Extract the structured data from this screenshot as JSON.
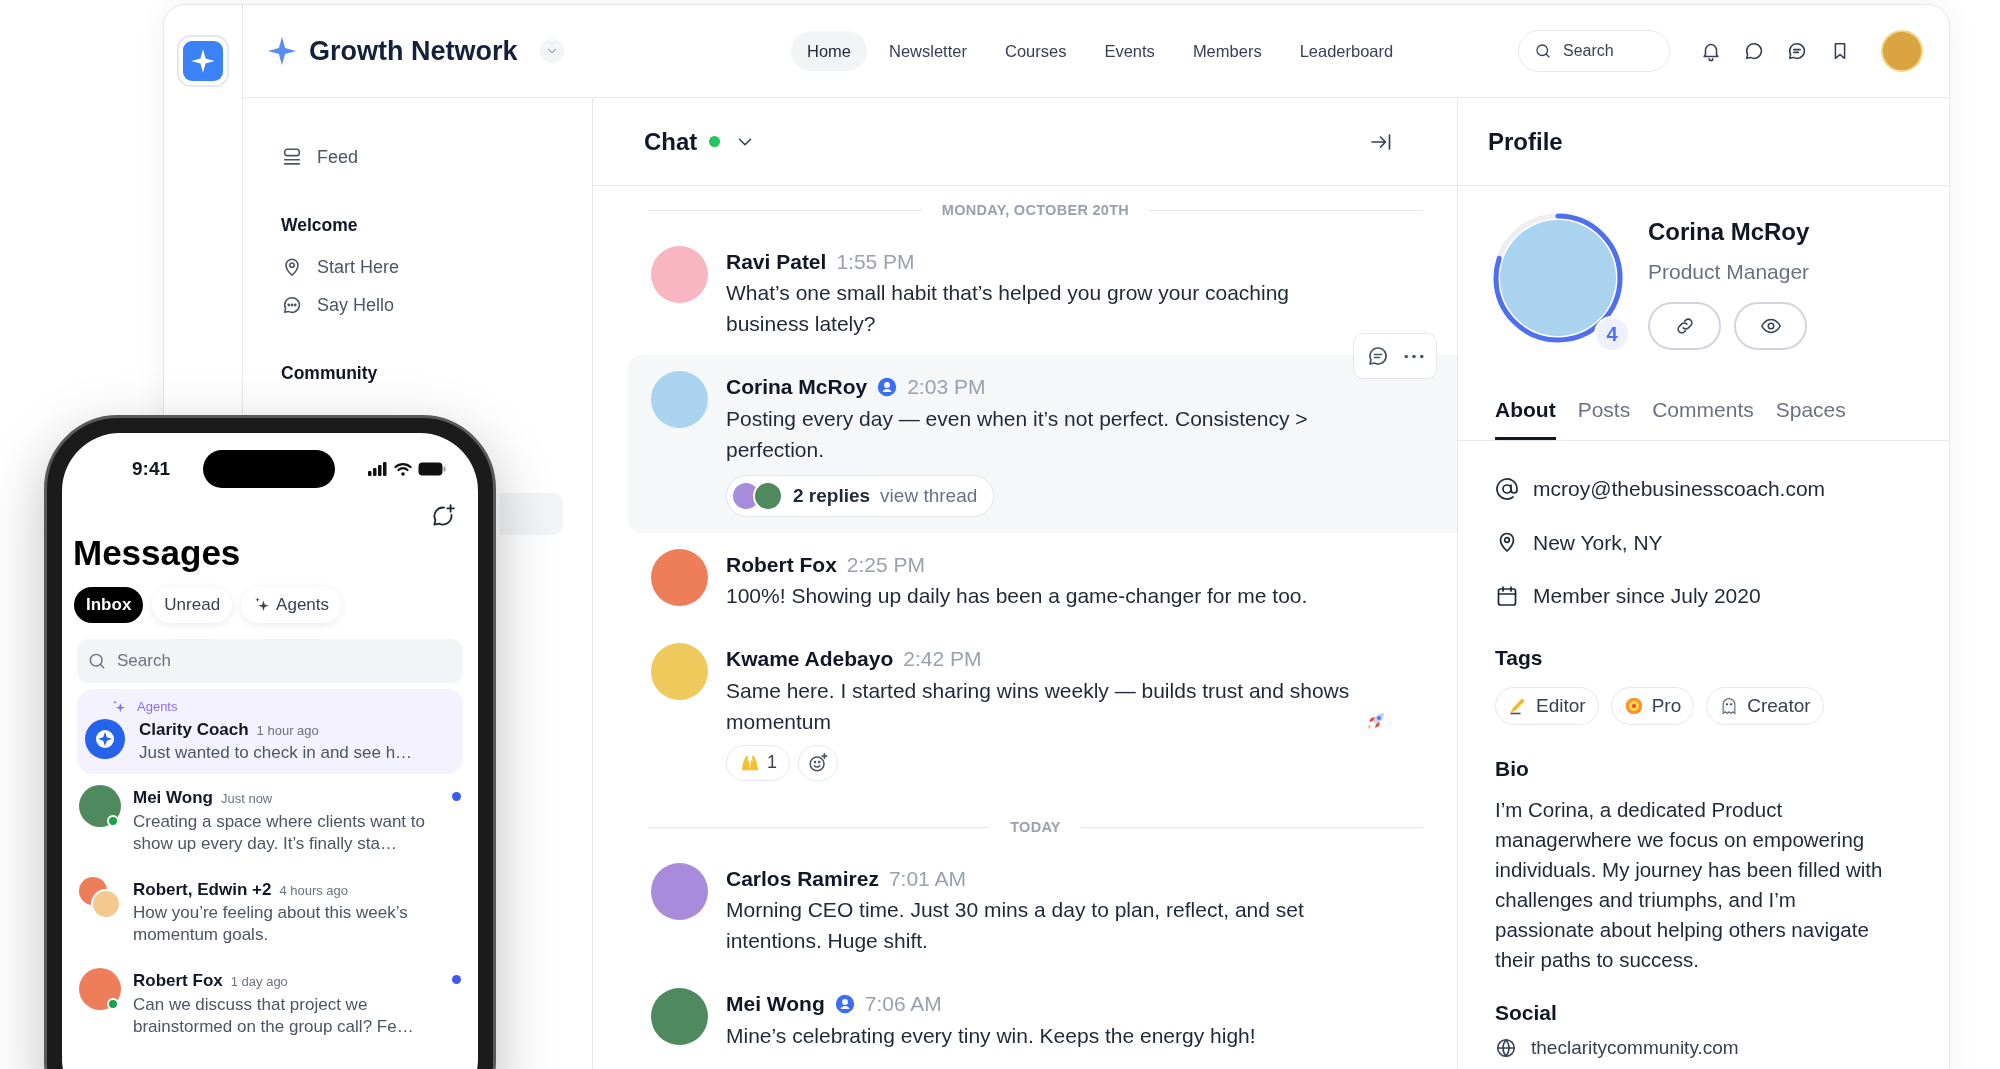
{
  "brand": {
    "name": "Growth Network"
  },
  "nav": [
    {
      "label": "Home",
      "selected": true
    },
    {
      "label": "Newsletter",
      "selected": false
    },
    {
      "label": "Courses",
      "selected": false
    },
    {
      "label": "Events",
      "selected": false
    },
    {
      "label": "Members",
      "selected": false
    },
    {
      "label": "Leaderboard",
      "selected": false
    }
  ],
  "search": {
    "placeholder": "Search"
  },
  "sidebar": {
    "sections": [
      {
        "items": [
          {
            "label": "Feed"
          }
        ]
      },
      {
        "heading": "Welcome",
        "items": [
          {
            "label": "Start Here"
          },
          {
            "label": "Say Hello"
          }
        ]
      },
      {
        "heading": "Community"
      }
    ]
  },
  "chat": {
    "title": "Chat",
    "online": true,
    "groups": [
      {
        "date": "MONDAY, OCTOBER 20TH",
        "messages": [
          {
            "name": "Ravi Patel",
            "time": "1:55 PM",
            "text": "What’s one small habit that’s helped you grow your coaching business lately?",
            "kind": "text",
            "verified": false,
            "highlighted": false,
            "color": "#f7b6c2"
          },
          {
            "name": "Corina McRoy",
            "time": "2:03 PM",
            "text": "Posting every day — even when it’s not perfect. Consistency > perfection.",
            "kind": "text",
            "verified": true,
            "highlighted": true,
            "color": "#a9d3ee",
            "thread": {
              "replies": "2 replies",
              "link": "view thread"
            }
          },
          {
            "name": "Robert Fox",
            "time": "2:25 PM",
            "text": "100%! Showing up daily has been a game-changer for me too.",
            "kind": "text",
            "verified": false,
            "highlighted": false,
            "color": "#ee7d5a"
          },
          {
            "name": "Kwame Adebayo",
            "time": "2:42 PM",
            "text": "Same here. I started sharing wins weekly — builds trust and shows momentum",
            "kind": "text-emoji",
            "verified": false,
            "highlighted": false,
            "color": "#efc95c",
            "reactions": [
              {
                "count": "1"
              }
            ]
          }
        ]
      },
      {
        "date": "TODAY",
        "messages": [
          {
            "name": "Carlos Ramirez",
            "time": "7:01 AM",
            "text": "Morning CEO time. Just 30 mins a day to plan, reflect, and set intentions. Huge shift.",
            "kind": "text",
            "verified": false,
            "highlighted": false,
            "color": "#a98bdc"
          },
          {
            "name": "Mei Wong",
            "time": "7:06 AM",
            "text": "Mine’s celebrating every tiny win. Keeps the energy high!",
            "kind": "text",
            "verified": true,
            "highlighted": false,
            "color": "#4f8a5f"
          }
        ]
      }
    ]
  },
  "profile": {
    "title": "Profile",
    "name": "Corina McRoy",
    "role": "Product Manager",
    "level": 0.8,
    "badge": "4",
    "tabs": [
      {
        "label": "About",
        "selected": true
      },
      {
        "label": "Posts",
        "selected": false
      },
      {
        "label": "Comments",
        "selected": false
      },
      {
        "label": "Spaces",
        "selected": false
      }
    ],
    "details": [
      {
        "kind": "email",
        "text": "mcroy@thebusinesscoach.com"
      },
      {
        "kind": "location",
        "text": "New York, NY"
      },
      {
        "kind": "joined",
        "text": "Member since July 2020"
      }
    ],
    "tags_heading": "Tags",
    "tags": [
      {
        "label": "Editor"
      },
      {
        "label": "Pro"
      },
      {
        "label": "Creator"
      }
    ],
    "bio_heading": "Bio",
    "bio": "I’m Corina, a dedicated Product managerwhere we focus on empowering individuals. My journey has been filled with challenges and triumphs, and I’m passionate about helping others navigate their paths to success.",
    "social_heading": "Social",
    "social": [
      "theclaritycommunity.com"
    ]
  },
  "phone": {
    "time": "9:41",
    "title": "Messages",
    "filters": [
      {
        "label": "Inbox",
        "selected": true,
        "kind": "plain"
      },
      {
        "label": "Unread",
        "selected": false,
        "kind": "plain"
      },
      {
        "label": "Agents",
        "selected": false,
        "kind": "agents"
      }
    ],
    "search": {
      "placeholder": "Search"
    },
    "conversations": [
      {
        "kind": "agent",
        "group": "Agents",
        "name": "Clarity Coach",
        "time": "1 hour ago",
        "preview": "Just wanted to check in and see h…",
        "unread": false,
        "online": false
      },
      {
        "kind": "person",
        "name": "Mei Wong",
        "time": "Just now",
        "preview": "Creating a space where clients want to show up every day. It’s finally sta…",
        "unread": true,
        "online": true,
        "color": "#4f8a5f"
      },
      {
        "kind": "group",
        "name": "Robert, Edwin +2",
        "time": "4 hours ago",
        "preview": "How you’re feeling about this week’s momentum goals.",
        "unread": false,
        "online": false
      },
      {
        "kind": "person",
        "name": "Robert Fox",
        "time": "1 day ago",
        "preview": "Can we discuss that project we brainstormed on the group call? Fe…",
        "unread": true,
        "online": true,
        "color": "#ee7d5a"
      }
    ]
  }
}
